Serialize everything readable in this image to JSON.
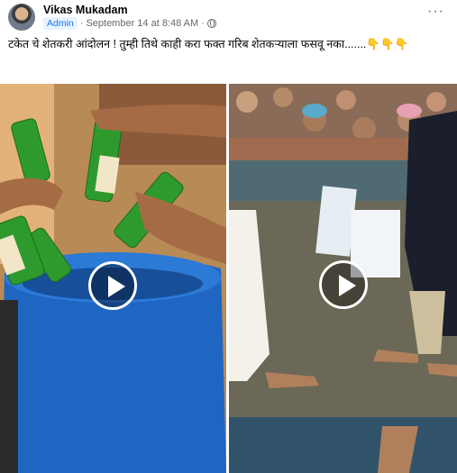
{
  "post": {
    "author": "Vikas Mukadam",
    "badge": "Admin",
    "time": "September 14 at 8:48 AM",
    "separator": "·",
    "more_label": "···",
    "caption": "टकेत चे शेतकरी आंदोलन ! तुम्ही तिथे काही करा फक्त गरिब शेतकऱ्याला फसवू नका.......👇👇👇"
  },
  "icons": {
    "globe": "globe-icon",
    "more": "more-options-icon",
    "play": "play-icon"
  },
  "colors": {
    "badge_bg": "#e7f3ff",
    "badge_text": "#1877f2",
    "meta_text": "#65676b",
    "drum_blue": "#1f66c2",
    "bottle_green": "#2e9a2e"
  },
  "media": [
    {
      "kind": "video",
      "subject": "liquor-bottles-poured-into-drum"
    },
    {
      "kind": "video",
      "subject": "crowd-around-truck-bed"
    }
  ]
}
